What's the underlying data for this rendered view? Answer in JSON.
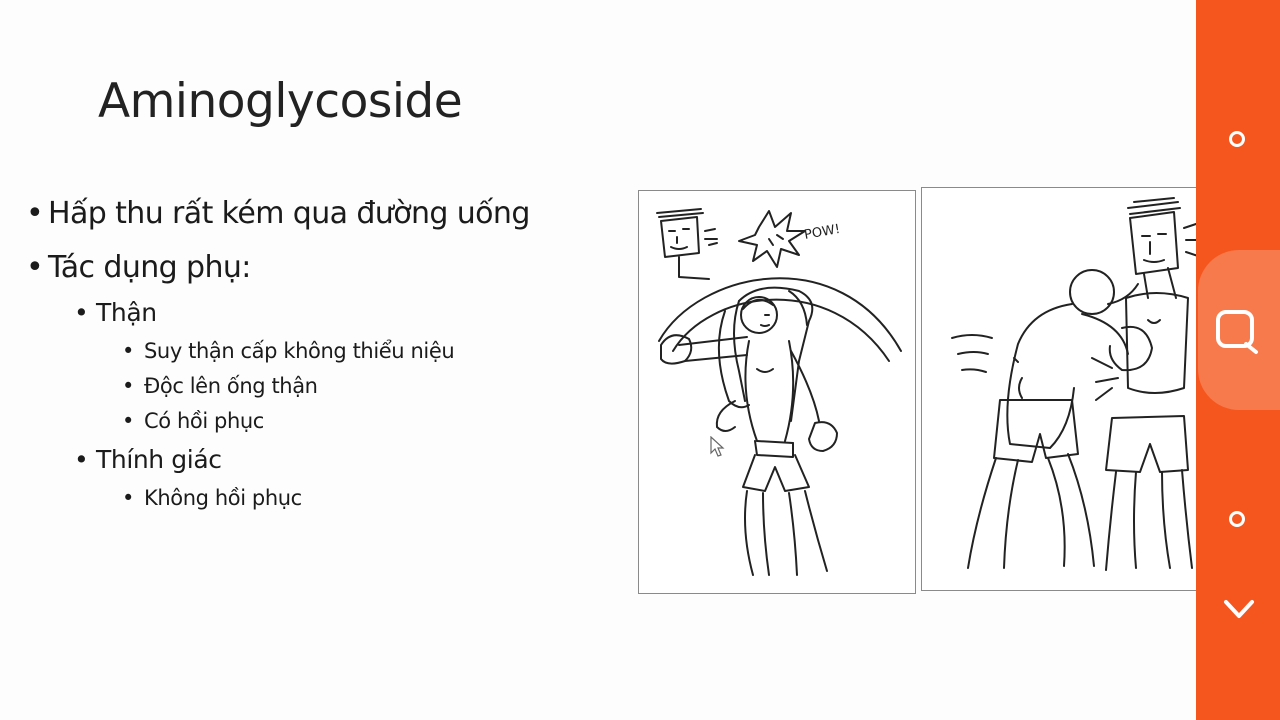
{
  "slide": {
    "title": "Aminoglycoside",
    "bullets": [
      {
        "level": 1,
        "text": "Hấp thu rất kém qua đường uống"
      },
      {
        "level": 1,
        "text": "Tác dụng phụ:"
      },
      {
        "level": 2,
        "text": "Thận"
      },
      {
        "level": 3,
        "text": "Suy thận cấp không thiểu niệu"
      },
      {
        "level": 3,
        "text": "Độc lên ống thận"
      },
      {
        "level": 3,
        "text": "Có hồi phục"
      },
      {
        "level": 2,
        "text": "Thính giác"
      },
      {
        "level": 3,
        "text": "Không hồi phục"
      }
    ],
    "cartoon_left": {
      "sound_effect": "POW!"
    }
  },
  "sidebar": {
    "color": "#f5561d",
    "highlight_color": "#f77a4c",
    "buttons": [
      "circle-icon",
      "search-icon",
      "circle-icon",
      "chevron-down-icon"
    ]
  }
}
